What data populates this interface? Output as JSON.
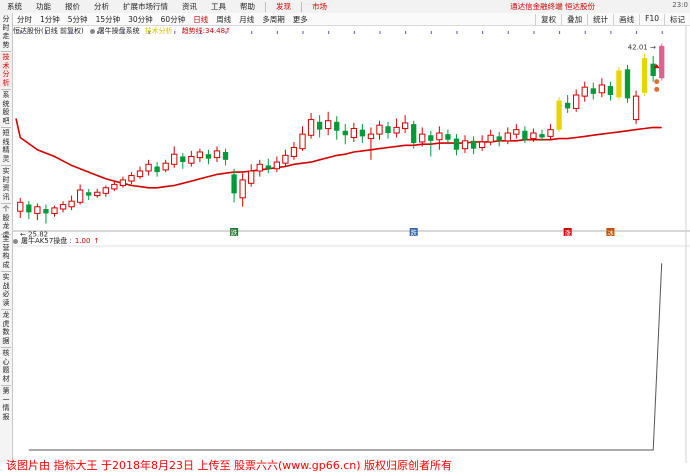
{
  "menubar": {
    "items": [
      "系统",
      "功能",
      "报价",
      "分析",
      "扩展市场行情",
      "资讯",
      "工具",
      "帮助"
    ],
    "extra": [
      "发现",
      "市场"
    ],
    "notice": "通达信金融终端  恒达股份",
    "clock": "23:0"
  },
  "toolbar": {
    "periods": [
      "分时",
      "1分钟",
      "5分钟",
      "15分钟",
      "30分钟",
      "60分钟",
      "日线",
      "周线",
      "月线",
      "多周期",
      "更多"
    ],
    "active_period": "日线",
    "tools": [
      "复权",
      "叠加",
      "统计",
      "画线",
      "F10",
      "标记"
    ]
  },
  "sidebar": {
    "items": [
      "分时走势",
      "技术分析",
      "系统股吧",
      "短线精灵",
      "实时资讯",
      "个股龙虎",
      "主营构成",
      "实战必读",
      "龙虎数据",
      "核心题材",
      "第一情报"
    ],
    "active": "技术分析"
  },
  "main_info": {
    "stock": "恒达股份(日线 前复权)",
    "indicator": "屠牛操盘系统",
    "highlight": "技术分析",
    "line_label": "趋势线:",
    "line_value": "34.48"
  },
  "sub_info": {
    "indicator": "屠牛AK57操盘",
    "label": "屠牛AK57操盘 :",
    "value": "1.00"
  },
  "chart_data": [
    {
      "type": "candlestick",
      "title": "恒达股份(日线 前复权)",
      "series_name": "趋势线",
      "high_label": "42.01",
      "low_label": "25.82",
      "last_trend_value": 34.48,
      "markers": [
        "跌",
        "跌",
        "涨",
        "冰"
      ],
      "candles": [
        {
          "o": 27.0,
          "c": 27.8,
          "h": 28.2,
          "l": 26.4
        },
        {
          "o": 27.6,
          "c": 26.9,
          "h": 27.9,
          "l": 26.3
        },
        {
          "o": 26.8,
          "c": 27.4,
          "h": 27.7,
          "l": 26.2
        },
        {
          "o": 27.2,
          "c": 26.8,
          "h": 27.6,
          "l": 25.9
        },
        {
          "o": 26.8,
          "c": 27.3,
          "h": 27.5,
          "l": 26.5
        },
        {
          "o": 27.2,
          "c": 27.6,
          "h": 27.9,
          "l": 26.9
        },
        {
          "o": 27.4,
          "c": 27.9,
          "h": 28.4,
          "l": 27.1
        },
        {
          "o": 27.8,
          "c": 28.9,
          "h": 29.4,
          "l": 27.6
        },
        {
          "o": 28.7,
          "c": 28.4,
          "h": 29.0,
          "l": 28.0
        },
        {
          "o": 28.4,
          "c": 28.7,
          "h": 29.0,
          "l": 28.2
        },
        {
          "o": 28.6,
          "c": 29.1,
          "h": 29.3,
          "l": 28.3
        },
        {
          "o": 29.0,
          "c": 29.4,
          "h": 29.7,
          "l": 28.8
        },
        {
          "o": 29.3,
          "c": 29.8,
          "h": 30.1,
          "l": 29.1
        },
        {
          "o": 29.7,
          "c": 30.2,
          "h": 30.5,
          "l": 29.4
        },
        {
          "o": 30.1,
          "c": 30.6,
          "h": 31.0,
          "l": 29.9
        },
        {
          "o": 30.6,
          "c": 31.2,
          "h": 31.6,
          "l": 30.2
        },
        {
          "o": 31.0,
          "c": 30.5,
          "h": 31.4,
          "l": 30.1
        },
        {
          "o": 30.7,
          "c": 31.3,
          "h": 31.6,
          "l": 30.5
        },
        {
          "o": 31.2,
          "c": 32.1,
          "h": 32.8,
          "l": 30.9
        },
        {
          "o": 31.9,
          "c": 31.4,
          "h": 32.2,
          "l": 30.8
        },
        {
          "o": 31.3,
          "c": 31.9,
          "h": 32.4,
          "l": 31.0
        },
        {
          "o": 31.8,
          "c": 32.3,
          "h": 32.6,
          "l": 31.4
        },
        {
          "o": 32.1,
          "c": 31.7,
          "h": 32.5,
          "l": 31.2
        },
        {
          "o": 31.8,
          "c": 32.4,
          "h": 32.8,
          "l": 31.4
        },
        {
          "o": 32.3,
          "c": 31.6,
          "h": 32.6,
          "l": 31.1
        },
        {
          "o": 30.3,
          "c": 28.6,
          "h": 30.8,
          "l": 27.8
        },
        {
          "o": 28.2,
          "c": 29.8,
          "h": 30.4,
          "l": 27.4
        },
        {
          "o": 29.5,
          "c": 30.6,
          "h": 31.2,
          "l": 29.2
        },
        {
          "o": 30.6,
          "c": 31.2,
          "h": 31.6,
          "l": 30.1
        },
        {
          "o": 31.1,
          "c": 30.8,
          "h": 31.7,
          "l": 30.4
        },
        {
          "o": 30.8,
          "c": 31.4,
          "h": 31.9,
          "l": 30.5
        },
        {
          "o": 31.3,
          "c": 32.0,
          "h": 32.5,
          "l": 31.0
        },
        {
          "o": 31.9,
          "c": 32.7,
          "h": 33.2,
          "l": 31.6
        },
        {
          "o": 32.6,
          "c": 33.9,
          "h": 34.6,
          "l": 32.4
        },
        {
          "o": 33.8,
          "c": 35.2,
          "h": 35.8,
          "l": 33.5
        },
        {
          "o": 35.0,
          "c": 34.3,
          "h": 35.6,
          "l": 33.6
        },
        {
          "o": 34.4,
          "c": 35.1,
          "h": 35.9,
          "l": 33.8
        },
        {
          "o": 35.0,
          "c": 34.2,
          "h": 35.5,
          "l": 33.4
        },
        {
          "o": 34.2,
          "c": 33.8,
          "h": 34.8,
          "l": 33.0
        },
        {
          "o": 33.6,
          "c": 34.4,
          "h": 34.9,
          "l": 33.2
        },
        {
          "o": 34.3,
          "c": 33.7,
          "h": 34.8,
          "l": 33.1
        },
        {
          "o": 33.5,
          "c": 33.9,
          "h": 34.5,
          "l": 31.6
        },
        {
          "o": 33.9,
          "c": 34.7,
          "h": 35.1,
          "l": 33.4
        },
        {
          "o": 34.6,
          "c": 34.0,
          "h": 35.0,
          "l": 33.5
        },
        {
          "o": 34.0,
          "c": 34.5,
          "h": 35.3,
          "l": 33.6
        },
        {
          "o": 34.4,
          "c": 34.9,
          "h": 35.6,
          "l": 34.0
        },
        {
          "o": 34.8,
          "c": 33.1,
          "h": 35.1,
          "l": 32.6
        },
        {
          "o": 33.2,
          "c": 33.9,
          "h": 34.5,
          "l": 32.8
        },
        {
          "o": 33.8,
          "c": 33.3,
          "h": 34.2,
          "l": 31.9
        },
        {
          "o": 33.4,
          "c": 34.0,
          "h": 34.6,
          "l": 32.5
        },
        {
          "o": 33.9,
          "c": 33.4,
          "h": 34.3,
          "l": 33.0
        },
        {
          "o": 33.5,
          "c": 32.5,
          "h": 33.9,
          "l": 32.0
        },
        {
          "o": 32.6,
          "c": 33.3,
          "h": 33.8,
          "l": 32.2
        },
        {
          "o": 33.3,
          "c": 32.6,
          "h": 33.7,
          "l": 32.1
        },
        {
          "o": 32.7,
          "c": 33.2,
          "h": 33.8,
          "l": 32.4
        },
        {
          "o": 33.2,
          "c": 33.8,
          "h": 34.3,
          "l": 32.9
        },
        {
          "o": 33.7,
          "c": 33.3,
          "h": 34.1,
          "l": 32.8
        },
        {
          "o": 33.3,
          "c": 34.0,
          "h": 34.5,
          "l": 33.0
        },
        {
          "o": 33.9,
          "c": 34.3,
          "h": 34.8,
          "l": 33.5
        },
        {
          "o": 34.2,
          "c": 33.4,
          "h": 34.6,
          "l": 33.1
        },
        {
          "o": 33.5,
          "c": 34.0,
          "h": 34.4,
          "l": 33.2
        },
        {
          "o": 33.9,
          "c": 33.6,
          "h": 34.3,
          "l": 33.3
        },
        {
          "o": 33.7,
          "c": 34.3,
          "h": 34.8,
          "l": 33.4
        },
        {
          "o": 34.3,
          "c": 36.9,
          "h": 37.2,
          "l": 34.1
        },
        {
          "o": 36.7,
          "c": 36.2,
          "h": 37.4,
          "l": 35.8
        },
        {
          "o": 36.2,
          "c": 37.4,
          "h": 37.9,
          "l": 35.9
        },
        {
          "o": 37.3,
          "c": 38.1,
          "h": 38.6,
          "l": 36.8
        },
        {
          "o": 38.0,
          "c": 37.5,
          "h": 38.5,
          "l": 37.0
        },
        {
          "o": 37.6,
          "c": 38.3,
          "h": 38.9,
          "l": 37.2
        },
        {
          "o": 38.2,
          "c": 37.4,
          "h": 38.6,
          "l": 36.9
        },
        {
          "o": 37.2,
          "c": 39.6,
          "h": 39.9,
          "l": 37.0
        },
        {
          "o": 39.7,
          "c": 37.1,
          "h": 40.1,
          "l": 36.7
        },
        {
          "o": 35.2,
          "c": 37.3,
          "h": 37.8,
          "l": 34.8
        },
        {
          "o": 37.6,
          "c": 40.7,
          "h": 41.1,
          "l": 37.3
        },
        {
          "o": 40.2,
          "c": 39.1,
          "h": 40.9,
          "l": 38.6
        },
        {
          "o": 38.9,
          "c": 41.8,
          "h": 42.01,
          "l": 38.7
        }
      ],
      "trend": [
        32.8,
        32.5,
        32.2,
        31.9,
        31.5,
        31.1,
        30.8,
        30.5,
        30.2,
        29.9,
        29.7,
        29.5,
        29.3,
        29.2,
        29.1,
        29.1,
        29.2,
        29.3,
        29.5,
        29.7,
        29.9,
        30.1,
        30.3,
        30.4,
        30.5,
        30.5,
        30.6,
        30.7,
        30.8,
        30.9,
        31.0,
        31.2,
        31.3,
        31.4,
        31.6,
        31.8,
        32.0,
        32.1,
        32.3,
        32.4,
        32.5,
        32.6,
        32.7,
        32.8,
        32.9,
        32.9,
        33.0,
        33.0,
        33.1,
        33.1,
        33.1,
        33.1,
        33.2,
        33.2,
        33.2,
        33.3,
        33.3,
        33.3,
        33.4,
        33.4,
        33.4,
        33.4,
        33.5,
        33.5,
        33.6,
        33.7,
        33.8,
        33.9,
        34.0,
        34.1,
        34.2,
        34.3,
        34.4,
        34.5,
        34.48
      ],
      "ylim": [
        25.5,
        42.5
      ]
    },
    {
      "type": "line",
      "title": "屠牛AK57操盘",
      "x_count": 75,
      "values_note_sparse": true,
      "values": [
        0,
        0,
        0,
        0,
        0,
        0,
        0,
        0,
        0,
        0,
        0,
        0,
        0,
        0,
        0,
        0,
        0,
        0,
        0,
        0,
        0,
        0,
        0,
        0,
        0,
        0,
        0,
        0,
        0,
        0,
        0,
        0,
        0,
        0,
        0,
        0,
        0,
        0,
        0,
        0,
        0,
        0,
        0,
        0,
        0,
        0,
        0,
        0,
        0,
        0,
        0,
        0,
        0,
        0,
        0,
        0,
        0,
        0,
        0,
        0,
        0,
        0,
        0,
        0,
        0,
        0,
        0,
        0,
        0,
        0,
        0,
        0,
        0,
        0,
        1.0
      ],
      "ylim": [
        0,
        1.05
      ]
    }
  ],
  "watermark": "该图片由 指标大王 于2018年8月23日 上传至 股票六六(www.gp66.cn) 版权归原创者所有"
}
